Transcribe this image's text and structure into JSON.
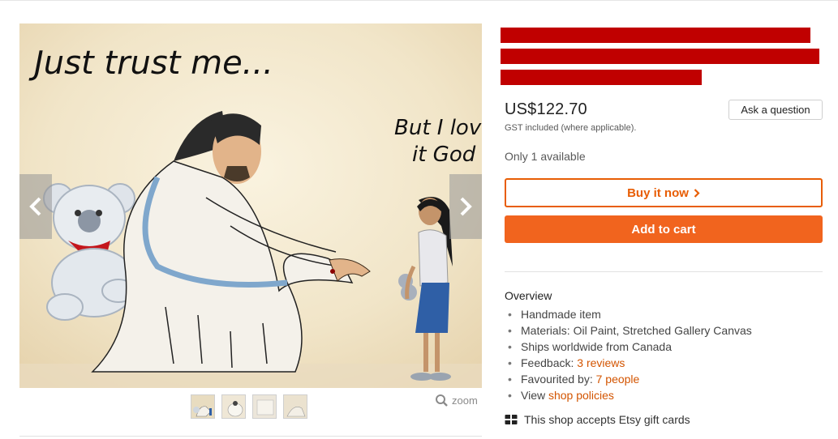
{
  "listing": {
    "painting": {
      "caption_main": "Just trust me...",
      "caption_side_line1": "But I love",
      "caption_side_line2": "it God"
    },
    "zoom_label": "zoom",
    "thumbnail_count": 4
  },
  "purchase": {
    "price": "US$122.70",
    "tax_note": "GST included (where applicable).",
    "ask_question_label": "Ask a question",
    "availability": "Only 1 available",
    "buy_now_label": "Buy it now",
    "add_to_cart_label": "Add to cart",
    "accent_color": "#f1641e"
  },
  "overview": {
    "title": "Overview",
    "items": {
      "handmade": "Handmade item",
      "materials": "Materials: Oil Paint, Stretched Gallery Canvas",
      "ships": "Ships worldwide from Canada",
      "feedback_prefix": "Feedback: ",
      "feedback_link": "3 reviews",
      "favourited_prefix": "Favourited by: ",
      "favourited_link": "7 people",
      "view_prefix": "View ",
      "view_link": "shop policies"
    }
  },
  "gift_card_note": "This shop accepts Etsy gift cards",
  "icons": [
    "chevron-left-icon",
    "chevron-right-icon",
    "zoom-icon",
    "chevron-right-small-icon",
    "gift-card-icon"
  ]
}
